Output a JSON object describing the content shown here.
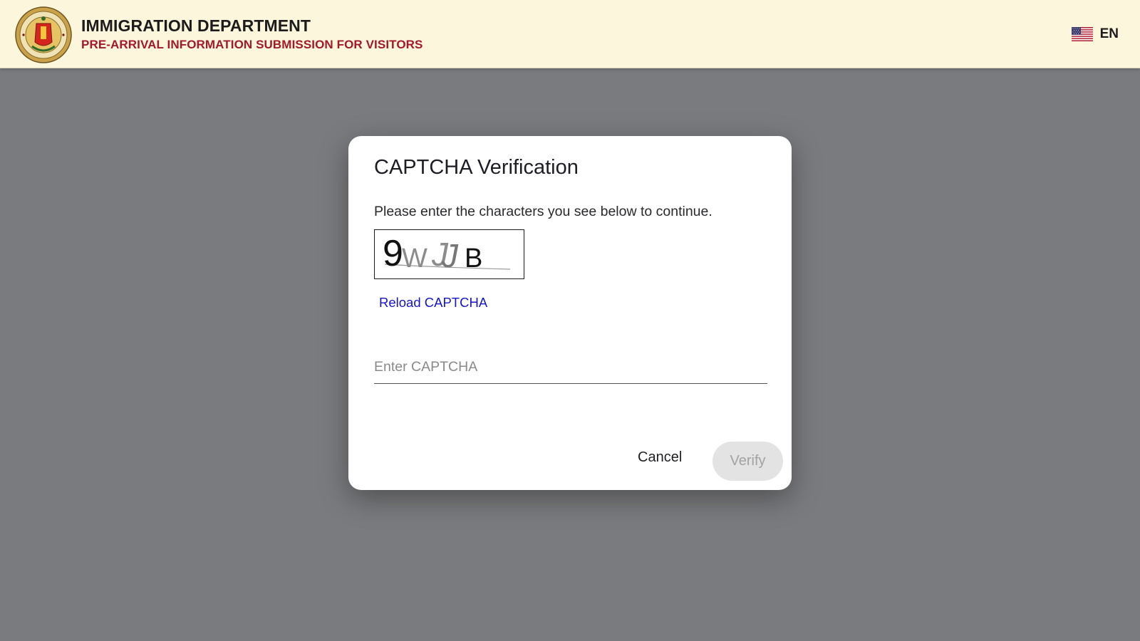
{
  "header": {
    "title": "IMMIGRATION DEPARTMENT",
    "subtitle": "PRE-ARRIVAL INFORMATION SUBMISSION FOR VISITORS",
    "emblem_icon": "national-emblem-icon",
    "language": {
      "code": "EN",
      "flag_icon": "us-flag-icon"
    }
  },
  "dialog": {
    "title": "CAPTCHA Verification",
    "message": "Please enter the characters you see below to continue.",
    "captcha": {
      "chars": [
        "9",
        "W",
        "J",
        "J",
        "B"
      ]
    },
    "reload_label": "Reload CAPTCHA",
    "input": {
      "value": "",
      "placeholder": "Enter CAPTCHA"
    },
    "cancel_label": "Cancel",
    "verify_label": "Verify",
    "verify_enabled": false
  },
  "colors": {
    "header_bg": "#fbf6dc",
    "subtitle": "#a3192a",
    "link": "#1515c8",
    "overlay": "#7a7b7e",
    "verify_disabled_bg": "#e3e3e3"
  }
}
